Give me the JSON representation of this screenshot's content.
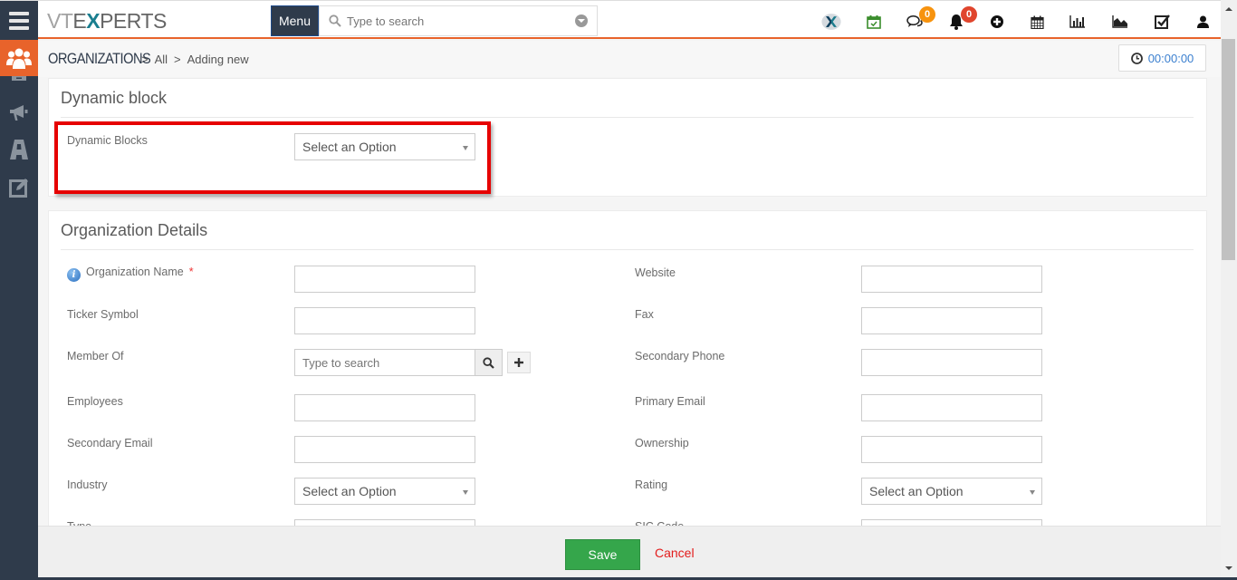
{
  "topbar": {
    "logo_light": "VT",
    "logo_mid": "E",
    "logo_x": "X",
    "logo_rest": "PERTS",
    "menu_label": "Menu",
    "search_placeholder": "Type to search",
    "icons": [
      "vtexperts-x-icon",
      "calendar-check-icon",
      "chat-icon",
      "bell-icon",
      "plus-circle-icon",
      "calendar-icon",
      "bar-chart-icon",
      "area-chart-icon",
      "checkbox-icon",
      "user-icon"
    ],
    "chat_badge": "0",
    "notification_badge": "0",
    "chat_badge_color": "#f7930e",
    "notification_badge_color": "#e0452d"
  },
  "sidebar": {
    "active_icon": "users-icon",
    "items": [
      "inbox-icon",
      "megaphone-icon",
      "road-icon",
      "edit-icon"
    ],
    "active_color": "#e8632b"
  },
  "breadcrumb": {
    "module": "ORGANIZATIONS",
    "separator": ">",
    "list": "All",
    "current": "Adding new"
  },
  "timer": {
    "value": "00:00:00"
  },
  "dynamic_block": {
    "title": "Dynamic block",
    "field_label": "Dynamic Blocks",
    "select_value": "Select an Option"
  },
  "org_details": {
    "title": "Organization Details",
    "left_fields": [
      {
        "label": "Organization Name",
        "required": "*",
        "type": "text",
        "value": ""
      },
      {
        "label": "Ticker Symbol",
        "type": "text",
        "value": ""
      },
      {
        "label": "Member Of",
        "type": "reference",
        "placeholder": "Type to search"
      },
      {
        "label": "Employees",
        "type": "text",
        "value": ""
      },
      {
        "label": "Secondary Email",
        "type": "text",
        "value": ""
      },
      {
        "label": "Industry",
        "type": "select",
        "value": "Select an Option"
      },
      {
        "label": "Type",
        "type": "select",
        "value": ""
      }
    ],
    "right_fields": [
      {
        "label": "Website",
        "type": "text",
        "value": ""
      },
      {
        "label": "Fax",
        "type": "text",
        "value": ""
      },
      {
        "label": "Secondary Phone",
        "type": "text",
        "value": ""
      },
      {
        "label": "Primary Email",
        "type": "text",
        "value": ""
      },
      {
        "label": "Ownership",
        "type": "text",
        "value": ""
      },
      {
        "label": "Rating",
        "type": "select",
        "value": "Select an Option"
      },
      {
        "label": "SIC Code",
        "type": "text",
        "value": ""
      }
    ]
  },
  "footer": {
    "save_label": "Save",
    "cancel_label": "Cancel",
    "save_color": "#35a64b",
    "cancel_color": "#e31c1c"
  }
}
